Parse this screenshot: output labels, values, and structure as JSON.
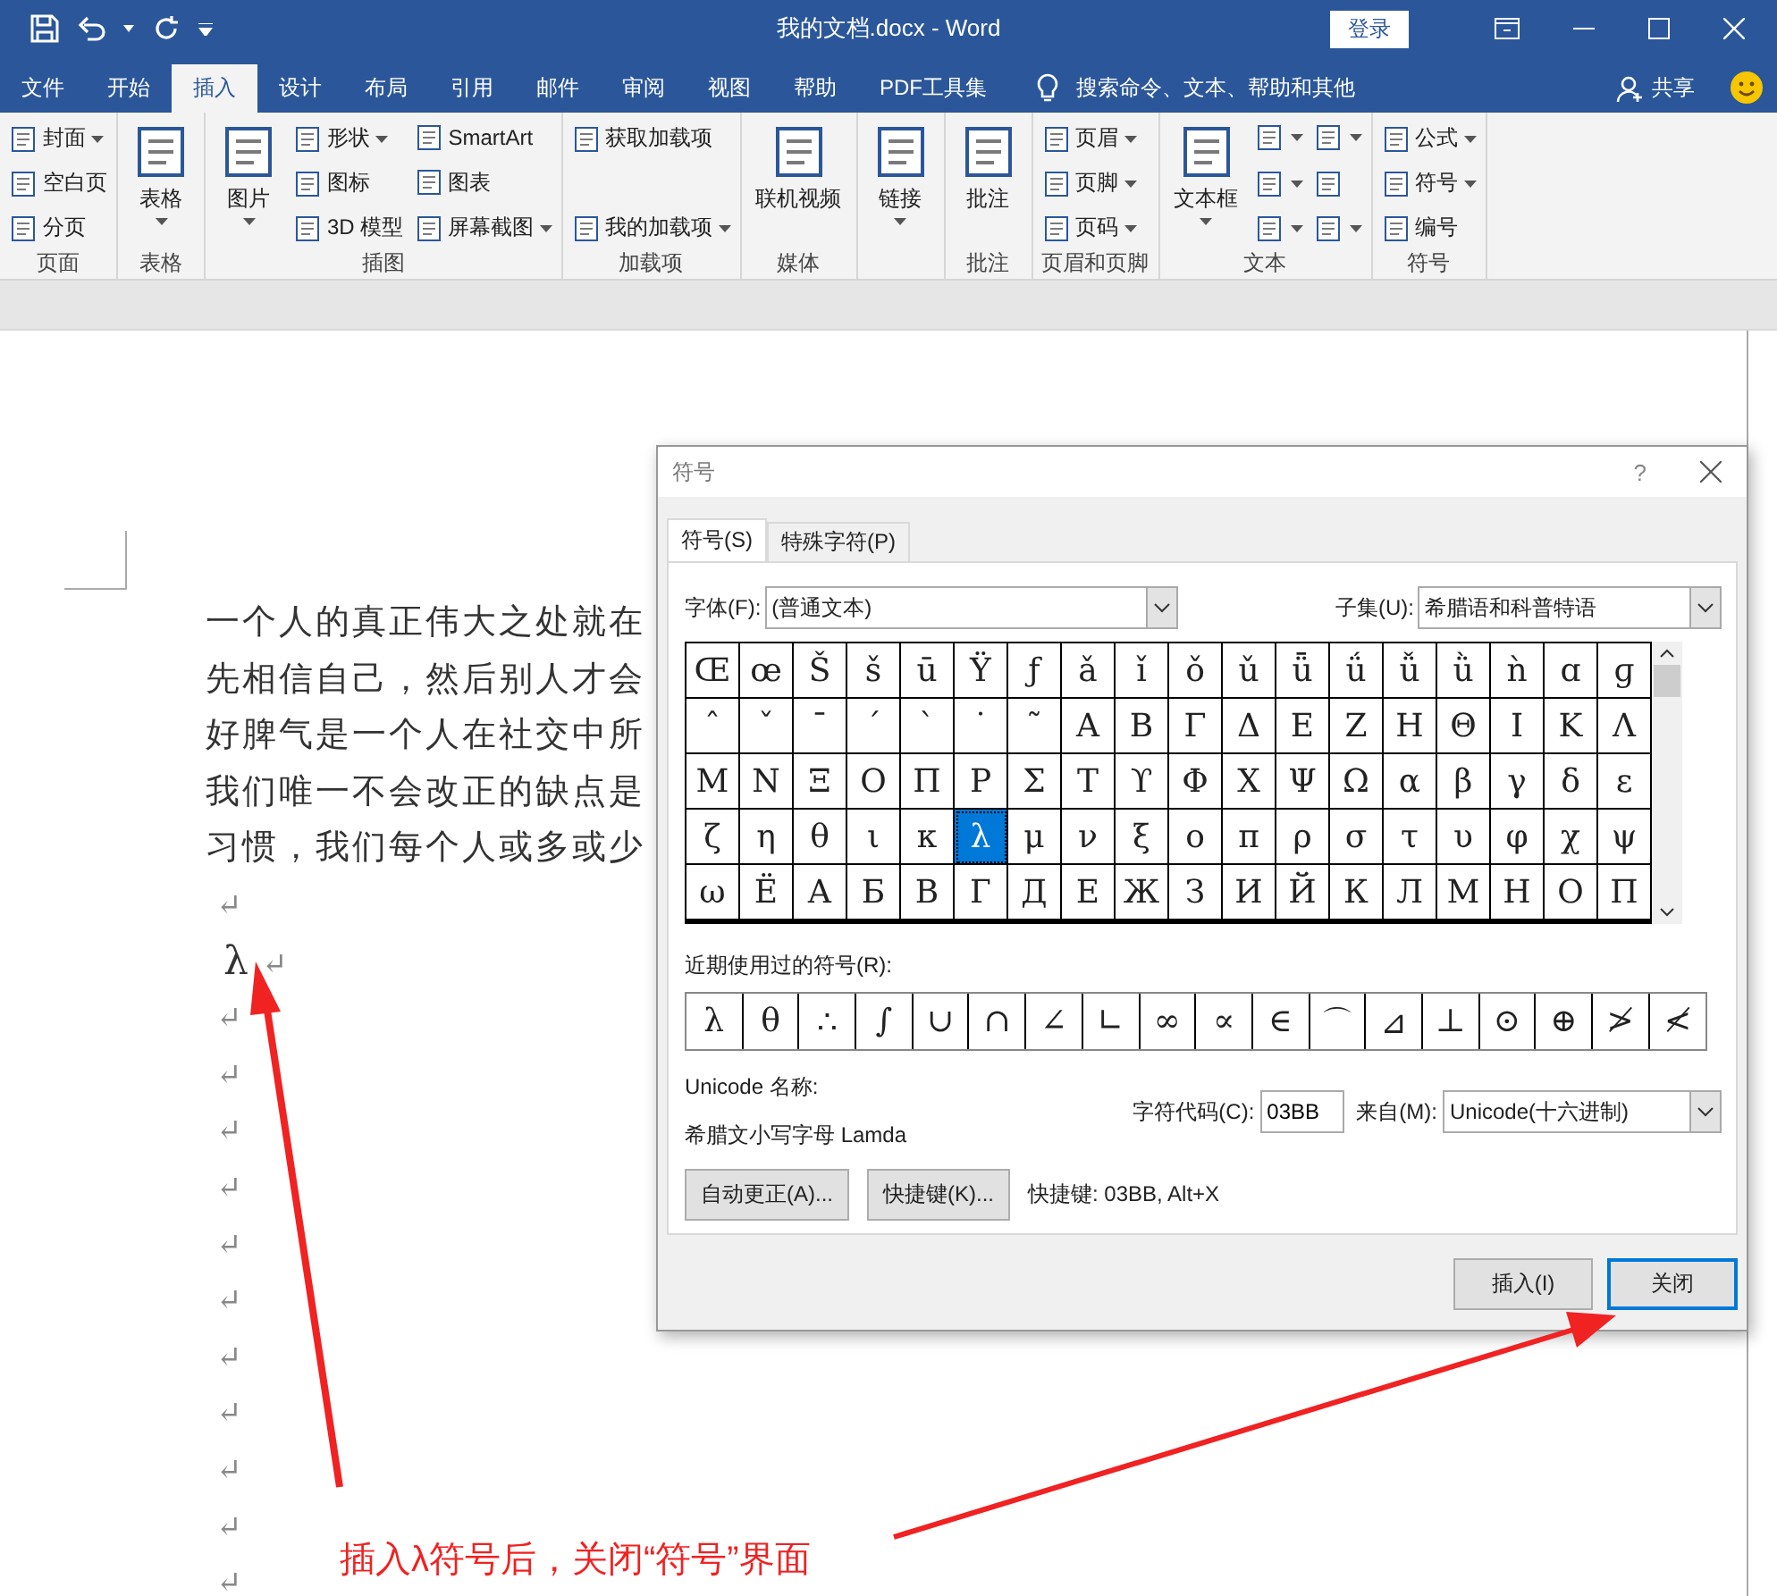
{
  "window": {
    "title": "我的文档.docx  -  Word",
    "sign_in": "登录"
  },
  "tabs": [
    {
      "label": "文件",
      "selected": false
    },
    {
      "label": "开始",
      "selected": false
    },
    {
      "label": "插入",
      "selected": true
    },
    {
      "label": "设计",
      "selected": false
    },
    {
      "label": "布局",
      "selected": false
    },
    {
      "label": "引用",
      "selected": false
    },
    {
      "label": "邮件",
      "selected": false
    },
    {
      "label": "审阅",
      "selected": false
    },
    {
      "label": "视图",
      "selected": false
    },
    {
      "label": "帮助",
      "selected": false
    },
    {
      "label": "PDF工具集",
      "selected": false
    }
  ],
  "tell_me": "搜索命令、文本、帮助和其他",
  "share": "共享",
  "ribbon": {
    "groups": [
      {
        "label": "页面",
        "columns": [
          [
            {
              "kind": "small",
              "label": "封面",
              "dropdown": true
            },
            {
              "kind": "small",
              "label": "空白页",
              "dropdown": false
            },
            {
              "kind": "small",
              "label": "分页",
              "dropdown": false
            }
          ]
        ]
      },
      {
        "label": "表格",
        "columns": [
          [
            {
              "kind": "large",
              "label": "表格",
              "dropdown": true
            }
          ]
        ]
      },
      {
        "label": "插图",
        "columns": [
          [
            {
              "kind": "large",
              "label": "图片",
              "dropdown": true
            }
          ],
          [
            {
              "kind": "small",
              "label": "形状",
              "dropdown": true
            },
            {
              "kind": "small",
              "label": "图标",
              "dropdown": false
            },
            {
              "kind": "small",
              "label": "3D 模型",
              "dropdown": false
            }
          ],
          [
            {
              "kind": "small",
              "label": "SmartArt",
              "dropdown": false
            },
            {
              "kind": "small",
              "label": "图表",
              "dropdown": false
            },
            {
              "kind": "small",
              "label": "屏幕截图",
              "dropdown": true
            }
          ]
        ]
      },
      {
        "label": "加载项",
        "columns": [
          [
            {
              "kind": "small",
              "label": "获取加载项",
              "dropdown": false
            },
            {
              "kind": "small",
              "label": "我的加载项",
              "dropdown": true
            }
          ]
        ]
      },
      {
        "label": "媒体",
        "columns": [
          [
            {
              "kind": "large",
              "label": "联机视频",
              "dropdown": false
            }
          ]
        ]
      },
      {
        "columns": [
          [
            {
              "kind": "large",
              "label": "链接",
              "dropdown": true
            }
          ]
        ]
      },
      {
        "label": "批注",
        "columns": [
          [
            {
              "kind": "large",
              "label": "批注",
              "dropdown": false
            }
          ]
        ]
      },
      {
        "label": "页眉和页脚",
        "columns": [
          [
            {
              "kind": "small",
              "label": "页眉",
              "dropdown": true
            },
            {
              "kind": "small",
              "label": "页脚",
              "dropdown": true
            },
            {
              "kind": "small",
              "label": "页码",
              "dropdown": true
            }
          ]
        ]
      },
      {
        "label": "文本",
        "columns": [
          [
            {
              "kind": "large",
              "label": "文本框",
              "dropdown": true
            }
          ],
          [
            {
              "kind": "icon",
              "dropdown": true
            },
            {
              "kind": "icon",
              "dropdown": true
            },
            {
              "kind": "icon",
              "dropdown": true
            }
          ],
          [
            {
              "kind": "icon",
              "dropdown": true
            },
            {
              "kind": "icon",
              "dropdown": false
            },
            {
              "kind": "icon",
              "dropdown": true
            }
          ]
        ]
      },
      {
        "label": "符号",
        "columns": [
          [
            {
              "kind": "small",
              "label": "公式",
              "dropdown": true
            },
            {
              "kind": "small",
              "label": "符号",
              "dropdown": true
            },
            {
              "kind": "small",
              "label": "编号",
              "dropdown": false
            }
          ]
        ]
      }
    ]
  },
  "document": {
    "text_lines": [
      "一个人的真正伟大之处就在",
      "先相信自己，然后别人才会",
      "好脾气是一个人在社交中所",
      "我们唯一不会改正的缺点是",
      "习惯，我们每个人或多或少"
    ],
    "lines": [
      {
        "mark": "↵"
      },
      {
        "symbol": "λ",
        "mark": "↵"
      },
      {
        "mark": "↵"
      },
      {
        "mark": "↵"
      },
      {
        "mark": "↵"
      },
      {
        "mark": "↵"
      },
      {
        "mark": "↵"
      },
      {
        "mark": "↵"
      },
      {
        "mark": "↵"
      },
      {
        "mark": "↵"
      },
      {
        "mark": "↵"
      },
      {
        "mark": "↵"
      },
      {
        "mark": "↵"
      }
    ]
  },
  "dialog": {
    "title": "符号",
    "help": "?",
    "tabs": [
      {
        "label": "符号(S)",
        "selected": true
      },
      {
        "label": "特殊字符(P)",
        "selected": false
      }
    ],
    "font_label": "字体(F):",
    "font_value": "(普通文本)",
    "subset_label": "子集(U):",
    "subset_value": "希腊语和科普特语",
    "grid": [
      [
        {
          "c": "Œ",
          "selected": false
        },
        {
          "c": "œ",
          "selected": false
        },
        {
          "c": "Š",
          "selected": false
        },
        {
          "c": "š",
          "selected": false
        },
        {
          "c": "ū",
          "selected": false
        },
        {
          "c": "Ÿ",
          "selected": false
        },
        {
          "c": "ƒ",
          "selected": false
        },
        {
          "c": "ǎ",
          "selected": false
        },
        {
          "c": "ǐ",
          "selected": false
        },
        {
          "c": "ǒ",
          "selected": false
        },
        {
          "c": "ǔ",
          "selected": false
        },
        {
          "c": "ǖ",
          "selected": false
        },
        {
          "c": "ǘ",
          "selected": false
        },
        {
          "c": "ǚ",
          "selected": false
        },
        {
          "c": "ǜ",
          "selected": false
        },
        {
          "c": "ǹ",
          "selected": false
        },
        {
          "c": "ɑ",
          "selected": false
        },
        {
          "c": "ɡ",
          "selected": false
        }
      ],
      [
        {
          "c": "ˆ",
          "selected": false
        },
        {
          "c": "ˇ",
          "selected": false
        },
        {
          "c": "ˉ",
          "selected": false
        },
        {
          "c": "ˊ",
          "selected": false
        },
        {
          "c": "ˋ",
          "selected": false
        },
        {
          "c": "˙",
          "selected": false
        },
        {
          "c": "˜",
          "selected": false
        },
        {
          "c": "Α",
          "selected": false
        },
        {
          "c": "Β",
          "selected": false
        },
        {
          "c": "Γ",
          "selected": false
        },
        {
          "c": "Δ",
          "selected": false
        },
        {
          "c": "Ε",
          "selected": false
        },
        {
          "c": "Ζ",
          "selected": false
        },
        {
          "c": "Η",
          "selected": false
        },
        {
          "c": "Θ",
          "selected": false
        },
        {
          "c": "Ι",
          "selected": false
        },
        {
          "c": "Κ",
          "selected": false
        },
        {
          "c": "Λ",
          "selected": false
        }
      ],
      [
        {
          "c": "Μ",
          "selected": false
        },
        {
          "c": "Ν",
          "selected": false
        },
        {
          "c": "Ξ",
          "selected": false
        },
        {
          "c": "Ο",
          "selected": false
        },
        {
          "c": "Π",
          "selected": false
        },
        {
          "c": "Ρ",
          "selected": false
        },
        {
          "c": "Σ",
          "selected": false
        },
        {
          "c": "Τ",
          "selected": false
        },
        {
          "c": "ϒ",
          "selected": false
        },
        {
          "c": "Φ",
          "selected": false
        },
        {
          "c": "Χ",
          "selected": false
        },
        {
          "c": "Ψ",
          "selected": false
        },
        {
          "c": "Ω",
          "selected": false
        },
        {
          "c": "α",
          "selected": false
        },
        {
          "c": "β",
          "selected": false
        },
        {
          "c": "γ",
          "selected": false
        },
        {
          "c": "δ",
          "selected": false
        },
        {
          "c": "ε",
          "selected": false
        }
      ],
      [
        {
          "c": "ζ",
          "selected": false
        },
        {
          "c": "η",
          "selected": false
        },
        {
          "c": "θ",
          "selected": false
        },
        {
          "c": "ι",
          "selected": false
        },
        {
          "c": "κ",
          "selected": false
        },
        {
          "c": "λ",
          "selected": true
        },
        {
          "c": "μ",
          "selected": false
        },
        {
          "c": "ν",
          "selected": false
        },
        {
          "c": "ξ",
          "selected": false
        },
        {
          "c": "ο",
          "selected": false
        },
        {
          "c": "π",
          "selected": false
        },
        {
          "c": "ρ",
          "selected": false
        },
        {
          "c": "σ",
          "selected": false
        },
        {
          "c": "τ",
          "selected": false
        },
        {
          "c": "υ",
          "selected": false
        },
        {
          "c": "φ",
          "selected": false
        },
        {
          "c": "χ",
          "selected": false
        },
        {
          "c": "ψ",
          "selected": false
        }
      ],
      [
        {
          "c": "ω",
          "selected": false
        },
        {
          "c": "Ё",
          "selected": false
        },
        {
          "c": "А",
          "selected": false
        },
        {
          "c": "Б",
          "selected": false
        },
        {
          "c": "В",
          "selected": false
        },
        {
          "c": "Г",
          "selected": false
        },
        {
          "c": "Д",
          "selected": false
        },
        {
          "c": "Е",
          "selected": false
        },
        {
          "c": "Ж",
          "selected": false
        },
        {
          "c": "З",
          "selected": false
        },
        {
          "c": "И",
          "selected": false
        },
        {
          "c": "Й",
          "selected": false
        },
        {
          "c": "К",
          "selected": false
        },
        {
          "c": "Л",
          "selected": false
        },
        {
          "c": "М",
          "selected": false
        },
        {
          "c": "Н",
          "selected": false
        },
        {
          "c": "О",
          "selected": false
        },
        {
          "c": "П",
          "selected": false
        }
      ]
    ],
    "recent_label": "近期使用过的符号(R):",
    "recent": [
      "λ",
      "θ",
      "∴",
      "∫",
      "∪",
      "∩",
      "∠",
      "∟",
      "∞",
      "∝",
      "∈",
      "⌒",
      "⊿",
      "⊥",
      "⊙",
      "⊕",
      "≯",
      "≮"
    ],
    "unicode_name_label": "Unicode 名称:",
    "unicode_name": "希腊文小写字母 Lamda",
    "char_code_label": "字符代码(C):",
    "char_code": "03BB",
    "from_label": "来自(M):",
    "from_value": "Unicode(十六进制)",
    "autocorrect_button": "自动更正(A)...",
    "shortcut_button": "快捷键(K)...",
    "shortcut_text": "快捷键: 03BB, Alt+X",
    "buttons": [
      {
        "label": "插入(I)",
        "default": false
      },
      {
        "label": "关闭",
        "default": true
      }
    ]
  },
  "annotation": {
    "text": "插入λ符号后，关闭“符号”界面"
  }
}
